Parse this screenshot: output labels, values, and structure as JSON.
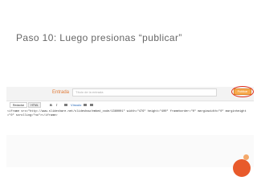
{
  "slide": {
    "title": "Paso 10: Luego presionas “publicar”"
  },
  "editor": {
    "entry_label": "Entrada",
    "title_placeholder": "Título de la entrada",
    "publish_label": "Publicar",
    "tabs": {
      "compose": "Redactar",
      "html": "HTML"
    },
    "toolbar": {
      "bold": "B",
      "italic": "I",
      "insert_label": "Vínculo"
    },
    "code": "<iframe src=\"http://www.slideshare.net/slideshow/embed_code/1360001\" width=\"476\" height=\"400\" frameborder=\"0\" marginwidth=\"0\" marginheight=\"0\" scrolling=\"no\"></iframe>"
  },
  "icons": [
    "link-icon",
    "image-icon",
    "video-icon"
  ],
  "colors": {
    "accent": "#e07b39",
    "publish_button": "#f7a94d",
    "highlight_ring": "#e0301e",
    "decor_circle": "#e85a2b"
  }
}
